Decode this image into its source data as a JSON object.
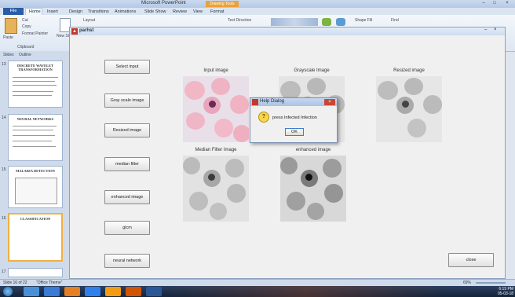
{
  "ppt": {
    "window_title": "Microsoft PowerPoint",
    "contextual_tab": "Drawing Tools",
    "tabs": [
      "File",
      "Home",
      "Insert",
      "Design",
      "Transitions",
      "Animations",
      "Slide Show",
      "Review",
      "View",
      "Format"
    ],
    "ribbon": {
      "clipboard": {
        "paste": "Paste",
        "cut": "Cut",
        "copy": "Copy",
        "format_painter": "Format Painter",
        "group": "Clipboard"
      },
      "new_slide": "New Slide",
      "layout": "Layout",
      "text_direction": "Text Direction",
      "shape_fill": "Shape Fill",
      "find": "Find"
    },
    "pane_tabs": [
      "Slides",
      "Outline"
    ],
    "slides": [
      {
        "num": "13",
        "title": "DISCRETE WAVELET TRANSFORMATION"
      },
      {
        "num": "14",
        "title": "NEURAL NETWORKS"
      },
      {
        "num": "15",
        "title": "MALARIA DETECTION"
      },
      {
        "num": "16",
        "title": "CLASSIFICATION"
      },
      {
        "num": "17",
        "title": ""
      }
    ],
    "status": {
      "slide_info": "Slide 16 of 22",
      "theme": "\"Office Theme\"",
      "zoom": "69%"
    }
  },
  "figure": {
    "title": "parhst",
    "buttons": [
      "Select input",
      "Gray scale image",
      "Resized image",
      "median filter",
      "enhanced image",
      "glcm",
      "neural network"
    ],
    "close_label": "close",
    "images": [
      {
        "id": "input",
        "title": "Input image"
      },
      {
        "id": "gray",
        "title": "Grayscale Image"
      },
      {
        "id": "resized",
        "title": "Resized image"
      },
      {
        "id": "median",
        "title": "Median Filter Image"
      },
      {
        "id": "enhanced",
        "title": "enhanced image"
      }
    ]
  },
  "dialog": {
    "title": "Help Dialog",
    "message": "press Infected Infection",
    "ok_label": "OK"
  },
  "taskbar": {
    "time": "6:15 PM",
    "date": "05-03-18"
  },
  "colors": {
    "accent": "#2a5ca8",
    "contextual": "#e8a33c",
    "dialog_close": "#c7463a"
  }
}
